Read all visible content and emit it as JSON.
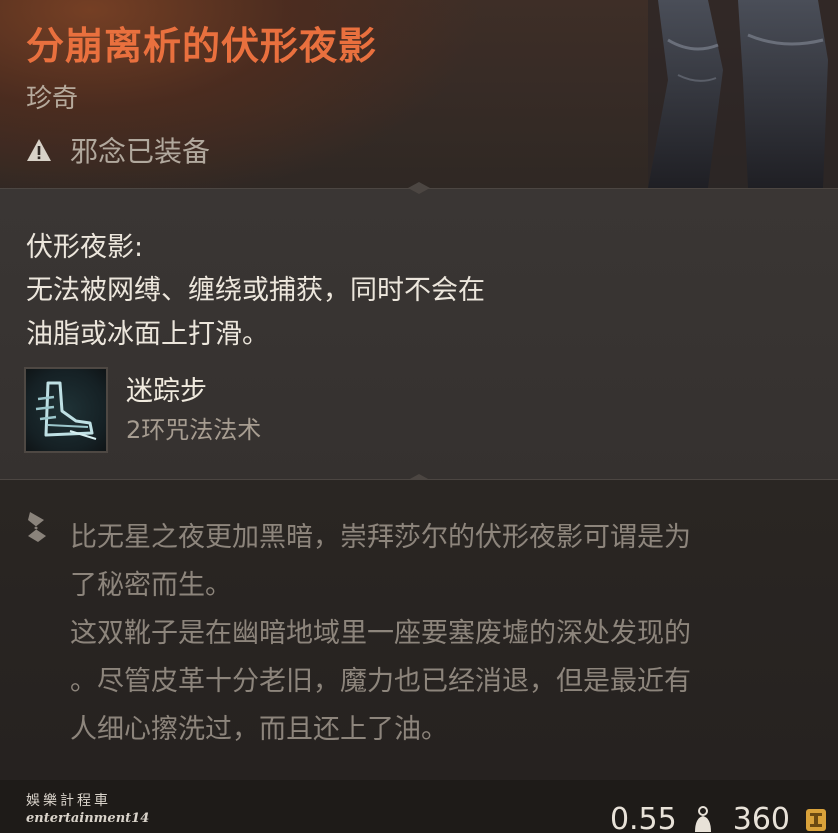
{
  "item": {
    "name": "分崩离析的伏形夜影",
    "rarity": "珍奇",
    "warning": "邪念已装备"
  },
  "effect": {
    "name": "伏形夜影:",
    "description_lines": [
      "无法被网缚、缠绕或捕获，同时不会在",
      "油脂或冰面上打滑。"
    ]
  },
  "spell": {
    "name": "迷踪步",
    "level": "2环咒法法术",
    "icon": "winged-boot-icon"
  },
  "lore": {
    "lines": [
      "比无星之夜更加黑暗，崇拜莎尔的伏形夜影可谓是为",
      "了秘密而生。",
      "这双靴子是在幽暗地域里一座要塞废墟的深处发现的",
      "。尽管皮革十分老旧，魔力也已经消退，但是最近有",
      "人细心擦洗过，而且还上了油。"
    ]
  },
  "footer": {
    "weight": "0.55",
    "value": "360",
    "watermark_cn": "娛樂計程車",
    "watermark_en": "entertainment14"
  },
  "colors": {
    "title": "#e9703e",
    "body_text": "#ece6dc",
    "lore_text": "#8d857c"
  }
}
